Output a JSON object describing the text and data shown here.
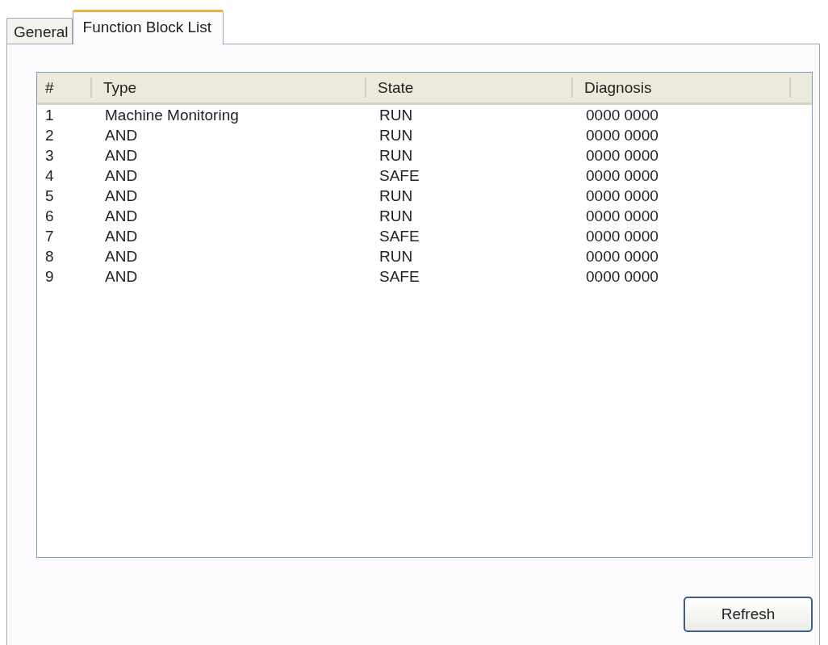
{
  "tabs": [
    {
      "label": "General",
      "selected": false
    },
    {
      "label": "Function Block List",
      "selected": true
    }
  ],
  "table": {
    "columns": [
      "#",
      "Type",
      "State",
      "Diagnosis"
    ],
    "rows": [
      {
        "number": "1",
        "type": "Machine Monitoring",
        "state": "RUN",
        "diagnosis": "0000 0000"
      },
      {
        "number": "2",
        "type": "AND",
        "state": "RUN",
        "diagnosis": "0000 0000"
      },
      {
        "number": "3",
        "type": "AND",
        "state": "RUN",
        "diagnosis": "0000 0000"
      },
      {
        "number": "4",
        "type": "AND",
        "state": "SAFE",
        "diagnosis": "0000 0000"
      },
      {
        "number": "5",
        "type": "AND",
        "state": "RUN",
        "diagnosis": "0000 0000"
      },
      {
        "number": "6",
        "type": "AND",
        "state": "RUN",
        "diagnosis": "0000 0000"
      },
      {
        "number": "7",
        "type": "AND",
        "state": "SAFE",
        "diagnosis": "0000 0000"
      },
      {
        "number": "8",
        "type": "AND",
        "state": "RUN",
        "diagnosis": "0000 0000"
      },
      {
        "number": "9",
        "type": "AND",
        "state": "SAFE",
        "diagnosis": "0000 0000"
      }
    ]
  },
  "buttons": [
    "Refresh"
  ]
}
